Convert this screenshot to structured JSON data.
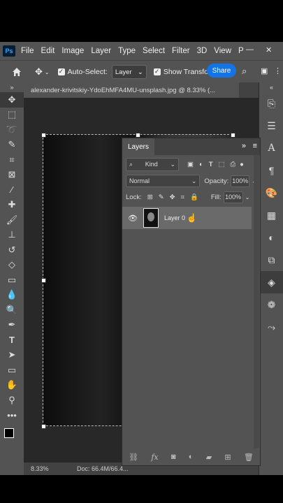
{
  "app": {
    "logo": "Ps"
  },
  "menubar": {
    "items": [
      "File",
      "Edit",
      "Image",
      "Layer",
      "Type",
      "Select",
      "Filter",
      "3D",
      "View",
      "P"
    ]
  },
  "options": {
    "auto_select_label": "Auto-Select:",
    "auto_select_value": "Layer",
    "show_transform_label": "Show Transform",
    "share_label": "Share"
  },
  "document": {
    "tab_title": "alexander-krivitskiy-YdoEhMFA4MU-unsplash.jpg @ 8.33% (..."
  },
  "status": {
    "zoom": "8.33%",
    "doc": "Doc: 66.4M/66.4..."
  },
  "layers_panel": {
    "title": "Layers",
    "kind_label": "Kind",
    "blend_mode": "Normal",
    "opacity_label": "Opacity:",
    "opacity_value": "100%",
    "lock_label": "Lock:",
    "fill_label": "Fill:",
    "fill_value": "100%",
    "layers": [
      {
        "name": "Layer 0",
        "visible": true
      }
    ]
  },
  "colors": {
    "accent": "#1473e6",
    "panel": "#535353",
    "canvas_bg": "#282828"
  }
}
